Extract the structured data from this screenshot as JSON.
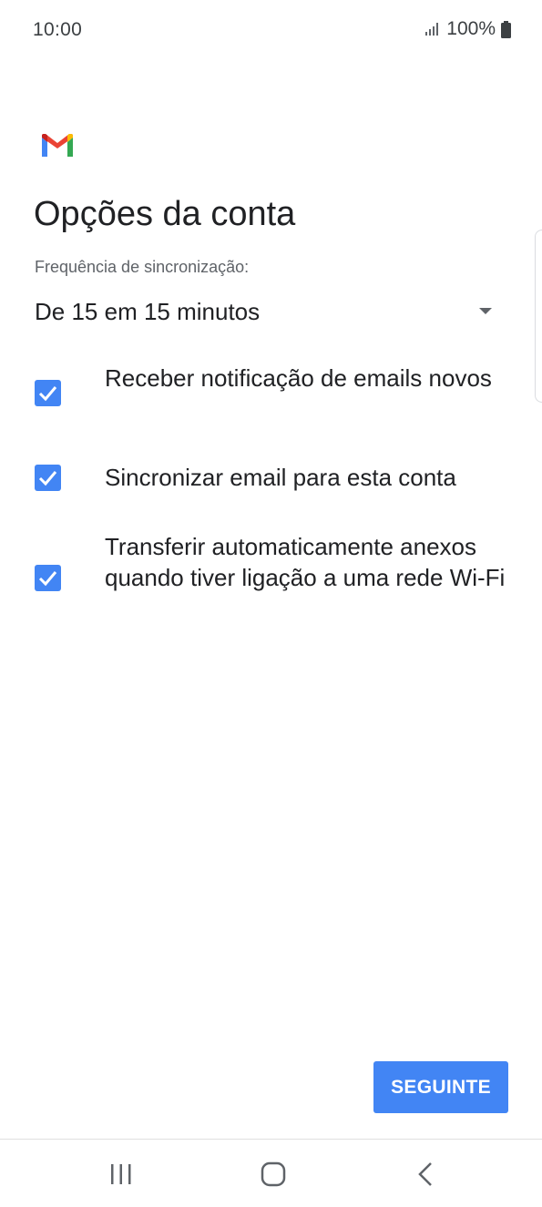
{
  "status_bar": {
    "time": "10:00",
    "battery": "100%",
    "icons": [
      "signal-icon",
      "battery-icon"
    ]
  },
  "app": {
    "logo": "gmail-logo-icon"
  },
  "page": {
    "title": "Opções da conta"
  },
  "sync": {
    "label": "Frequência de sincronização:",
    "selected_value": "De 15 em 15 minutos"
  },
  "options": [
    {
      "label": "Receber notificação de emails novos",
      "checked": true
    },
    {
      "label": "Sincronizar email para esta conta",
      "checked": true
    },
    {
      "label": "Transferir automaticamente anexos quando tiver ligação a uma rede Wi-Fi",
      "checked": true
    }
  ],
  "actions": {
    "next_label": "SEGUINTE"
  },
  "nav_bar": {
    "icons": [
      "recent-apps-icon",
      "home-icon",
      "back-icon"
    ]
  },
  "colors": {
    "accent": "#4285f4",
    "text_primary": "#202124",
    "text_secondary": "#5f6368"
  }
}
